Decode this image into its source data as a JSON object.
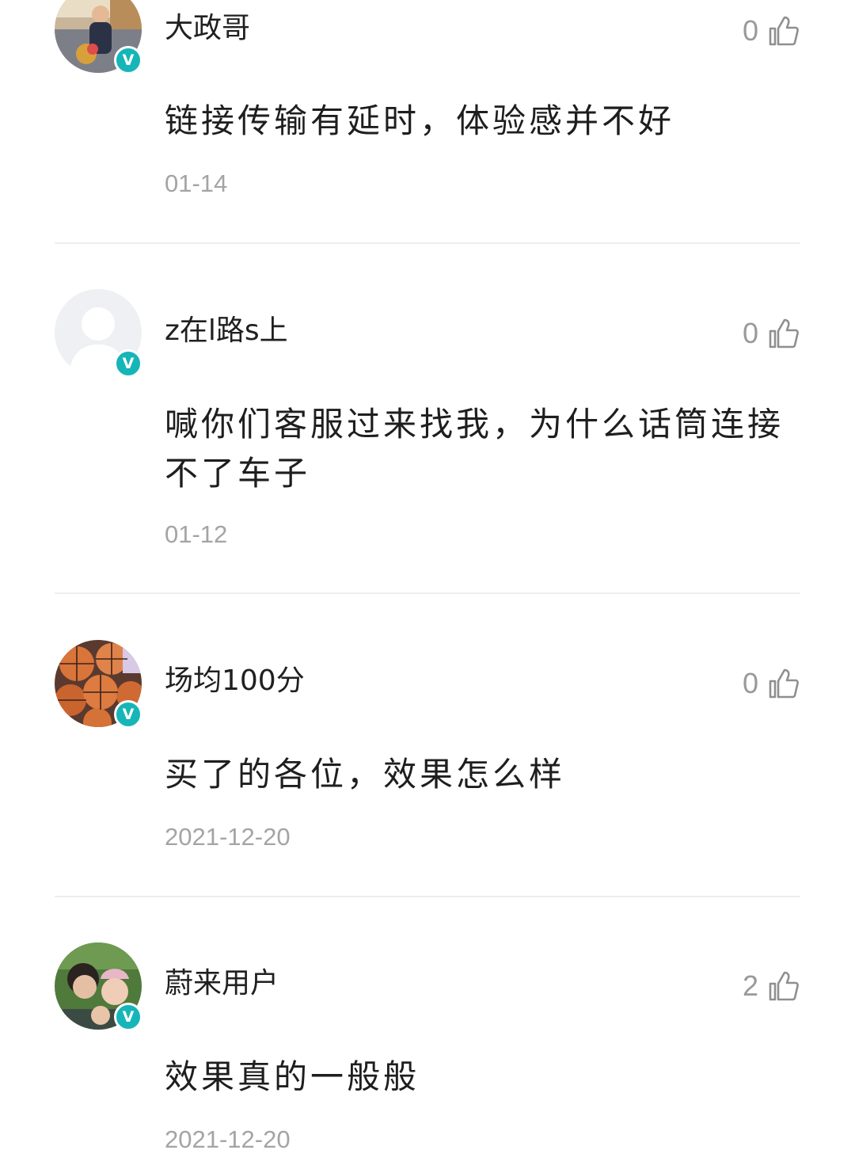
{
  "comments": [
    {
      "username": "大政哥",
      "likes": "0",
      "text": "链接传输有延时，体验感并不好",
      "date": "01-14",
      "verified_mark": "V"
    },
    {
      "username": "z在l路s上",
      "likes": "0",
      "text": "喊你们客服过来找我，为什么话筒连接不了车子",
      "date": "01-12",
      "verified_mark": "V"
    },
    {
      "username": "场均100分",
      "likes": "0",
      "text": "买了的各位，效果怎么样",
      "date": "2021-12-20",
      "verified_mark": "V"
    },
    {
      "username": "蔚来用户",
      "likes": "2",
      "text": "效果真的一般般",
      "date": "2021-12-20",
      "verified_mark": "V"
    }
  ],
  "colors": {
    "verified_badge": "#16b5b8",
    "secondary_text": "#a4a4a4",
    "divider": "#eeeeee"
  },
  "icons": {
    "like": "thumbs-up-icon",
    "verified": "verified-badge-icon"
  }
}
